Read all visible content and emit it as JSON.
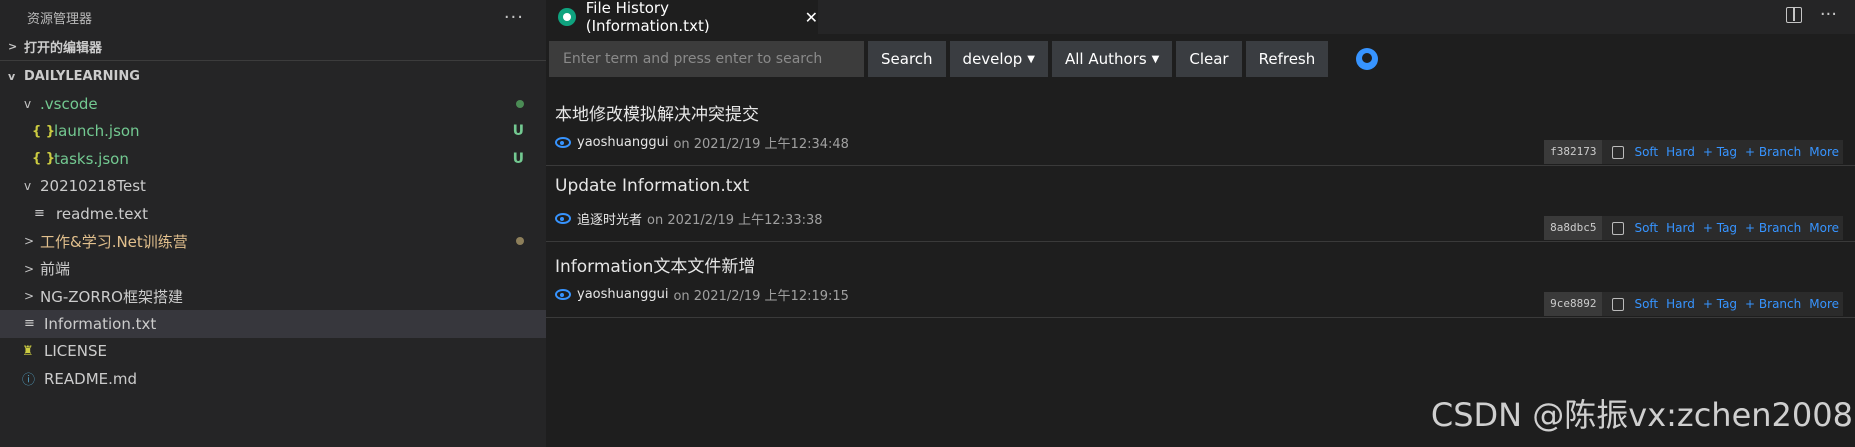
{
  "sidebar": {
    "title": "资源管理器",
    "more": "···",
    "open_editors": "打开的编辑器",
    "workspace": "DAILYLEARNING",
    "items": [
      {
        "label": ".vscode",
        "chevron": "v",
        "badge": "",
        "dot": "#5c9e5c"
      },
      {
        "label": "launch.json",
        "icon": "{ }",
        "badge": "U"
      },
      {
        "label": "tasks.json",
        "icon": "{ }",
        "badge": "U"
      },
      {
        "label": "20210218Test",
        "chevron": "v"
      },
      {
        "label": "readme.text",
        "icon": "≡"
      },
      {
        "label": "工作&学习.Net训练营",
        "chevron": ">",
        "dot": "#8d7f5a"
      },
      {
        "label": "前端",
        "chevron": ">"
      },
      {
        "label": "NG-ZORRO框架搭建",
        "chevron": ">"
      },
      {
        "label": "Information.txt",
        "icon": "≡"
      },
      {
        "label": "LICENSE",
        "icon": "♜"
      },
      {
        "label": "README.md",
        "icon": "ⓘ"
      }
    ]
  },
  "editor": {
    "tab_title": "File History (Information.txt)",
    "tab_close": "✕",
    "more": "···",
    "search_placeholder": "Enter term and press enter to search",
    "buttons": {
      "search": "Search",
      "branch": "develop",
      "authors": "All Authors",
      "clear": "Clear",
      "refresh": "Refresh"
    }
  },
  "commits": [
    {
      "title": "本地修改模拟解决冲突提交",
      "author": "yaoshuanggui",
      "date": "on 2021/2/19 上午12:34:48",
      "hash": "f382173"
    },
    {
      "title": "Update Information.txt",
      "author": "追逐时光者",
      "date": "on 2021/2/19 上午12:33:38",
      "hash": "8a8dbc5"
    },
    {
      "title": "Information文本文件新增",
      "author": "yaoshuanggui",
      "date": "on 2021/2/19 上午12:19:15",
      "hash": "9ce8892"
    }
  ],
  "commit_actions": {
    "soft": "Soft",
    "hard": "Hard",
    "tag": "+ Tag",
    "branch": "+ Branch",
    "more": "More"
  },
  "watermark": "CSDN @陈振vx:zchen2008",
  "colors": {
    "accent": "#3794ff",
    "untracked": "#73c991",
    "modified": "#e2c08d"
  }
}
